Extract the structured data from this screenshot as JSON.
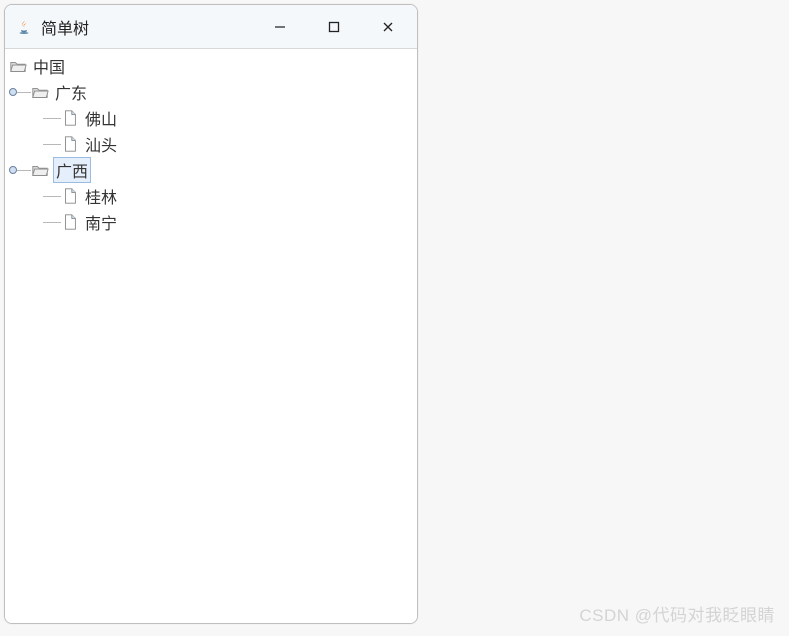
{
  "window": {
    "title": "简单树",
    "minimize_label": "Minimize",
    "maximize_label": "Maximize",
    "close_label": "Close"
  },
  "tree": {
    "root": {
      "label": "中国",
      "type": "folder",
      "expanded": true,
      "selected": false
    },
    "children": [
      {
        "label": "广东",
        "type": "folder",
        "expanded": true,
        "selected": false,
        "children": [
          {
            "label": "佛山",
            "type": "leaf",
            "selected": false
          },
          {
            "label": "汕头",
            "type": "leaf",
            "selected": false
          }
        ]
      },
      {
        "label": "广西",
        "type": "folder",
        "expanded": true,
        "selected": true,
        "children": [
          {
            "label": "桂林",
            "type": "leaf",
            "selected": false
          },
          {
            "label": "南宁",
            "type": "leaf",
            "selected": false
          }
        ]
      }
    ]
  },
  "watermark": "CSDN @代码对我眨眼睛"
}
